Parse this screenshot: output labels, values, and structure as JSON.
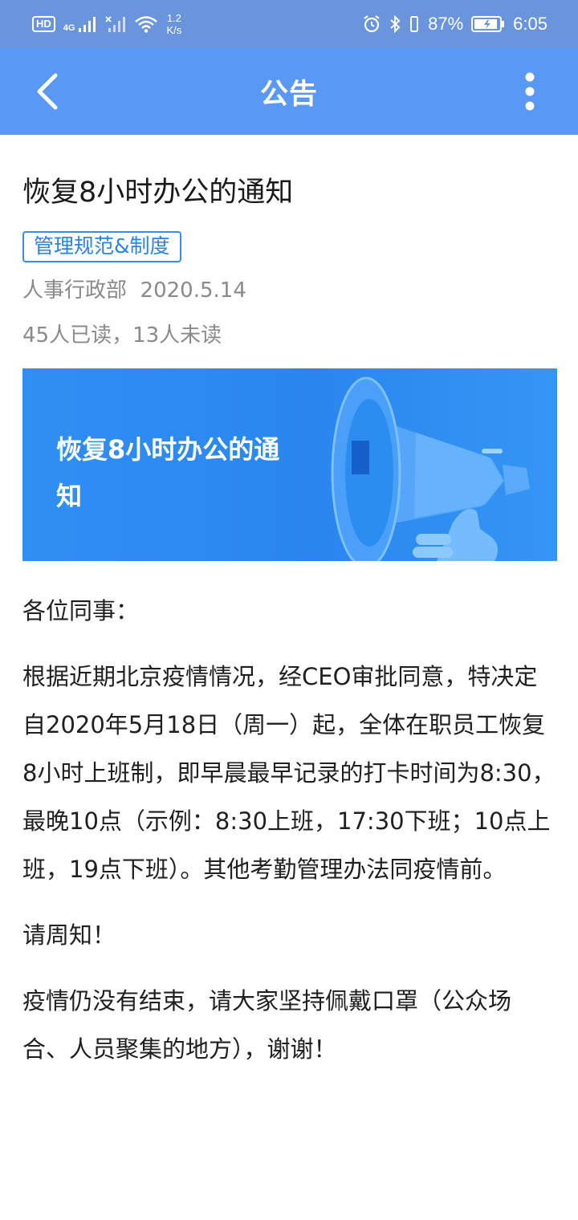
{
  "status_bar": {
    "hd": "HD",
    "network": "4G",
    "speed_value": "1.2",
    "speed_unit": "K/s",
    "battery": "87%",
    "time": "6:05"
  },
  "app_bar": {
    "title": "公告",
    "back_icon": "chevron-left-icon",
    "menu_icon": "more-vertical-icon"
  },
  "article": {
    "title": "恢复8小时办公的通知",
    "category": "管理规范&制度",
    "author": "人事行政部",
    "date": "2020.5.14",
    "read_status": "45人已读，13人未读",
    "banner_title": "恢复8小时办公的通知",
    "salutation": "各位同事：",
    "paragraphs": [
      "根据近期北京疫情情况，经CEO审批同意，特决定自2020年5月18日（周一）起，全体在职员工恢复8小时上班制，即早晨最早记录的打卡时间为8:30，最晚10点（示例：8:30上班，17:30下班；10点上班，19点下班）。其他考勤管理办法同疫情前。",
      "请周知！",
      "疫情仍没有结束，请大家坚持佩戴口罩（公众场合、人员聚集的地方），谢谢！"
    ]
  },
  "colors": {
    "status_bar": "#6a95dc",
    "app_bar": "#5a98f5",
    "tag_border": "#3a8ce8",
    "banner": "#2f8ff3"
  }
}
